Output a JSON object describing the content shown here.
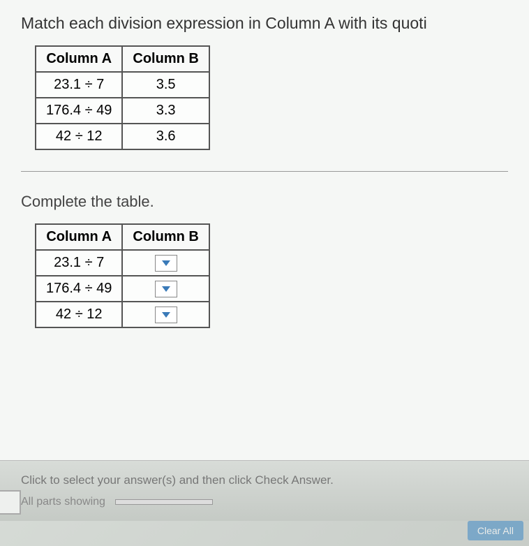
{
  "instruction": "Match each division expression in Column A with its quoti",
  "reference_table": {
    "headers": [
      "Column A",
      "Column B"
    ],
    "rows": [
      {
        "a": "23.1 ÷ 7",
        "b": "3.5"
      },
      {
        "a": "176.4 ÷ 49",
        "b": "3.3"
      },
      {
        "a": "42 ÷ 12",
        "b": "3.6"
      }
    ]
  },
  "sub_instruction": "Complete the table.",
  "answer_table": {
    "headers": [
      "Column A",
      "Column B"
    ],
    "rows": [
      {
        "a": "23.1 ÷ 7"
      },
      {
        "a": "176.4 ÷ 49"
      },
      {
        "a": "42 ÷ 12"
      }
    ]
  },
  "footer": {
    "hint": "Click to select your answer(s) and then click Check Answer.",
    "parts_label": "All parts showing",
    "button": "Clear All"
  }
}
